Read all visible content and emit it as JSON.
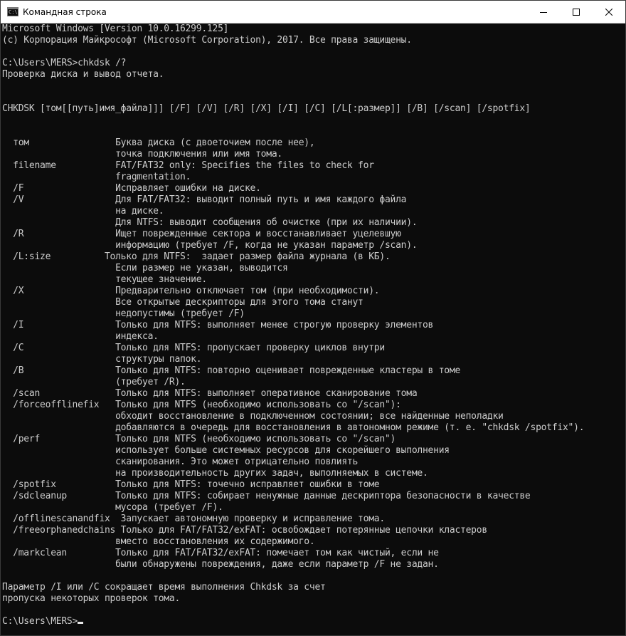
{
  "window": {
    "title": "Командная строка",
    "icon": "cmd-icon",
    "icon_glyph": "C:\\"
  },
  "console": {
    "lines": [
      "Microsoft Windows [Version 10.0.16299.125]",
      "(c) Корпорация Майкрософт (Microsoft Corporation), 2017. Все права защищены.",
      "",
      "C:\\Users\\MERS>chkdsk /?",
      "Проверка диска и вывод отчета.",
      "",
      "",
      "CHKDSK [том[[путь]имя_файла]]] [/F] [/V] [/R] [/X] [/I] [/C] [/L[:размер]] [/B] [/scan] [/spotfix]",
      "",
      "",
      "  том                Буква диска (с двоеточием после нее),",
      "                     точка подключения или имя тома.",
      "  filename           FAT/FAT32 only: Specifies the files to check for",
      "                     fragmentation.",
      "  /F                 Исправляет ошибки на диске.",
      "  /V                 Для FAT/FAT32: выводит полный путь и имя каждого файла",
      "                     на диске.",
      "                     Для NTFS: выводит сообщения об очистке (при их наличии).",
      "  /R                 Ищет поврежденные сектора и восстанавливает уцелевшую",
      "                     информацию (требует /F, когда не указан параметр /scan).",
      "  /L:size          Только для NTFS:  задает размер файла журнала (в КБ).",
      "                     Если размер не указан, выводится",
      "                     текущее значение.",
      "  /X                 Предварительно отключает том (при необходимости).",
      "                     Все открытые дескрипторы для этого тома станут",
      "                     недопустимы (требует /F)",
      "  /I                 Только для NTFS: выполняет менее строгую проверку элементов",
      "                     индекса.",
      "  /C                 Только для NTFS: пропускает проверку циклов внутри",
      "                     структуры папок.",
      "  /B                 Только для NTFS: повторно оценивает поврежденные кластеры в томе",
      "                     (требует /R).",
      "  /scan              Только для NTFS: выполняет оперативное сканирование тома",
      "  /forceofflinefix   Только для NTFS (необходимо использовать со \"/scan\"):",
      "                     обходит восстановление в подключенном состоянии; все найденные неполадки",
      "                     добавляются в очередь для восстановления в автономном режиме (т. е. \"chkdsk /spotfix\").",
      "  /perf              Только для NTFS (необходимо использовать со \"/scan\")",
      "                     использует больше системных ресурсов для скорейшего выполнения",
      "                     сканирования. Это может отрицательно повлиять",
      "                     на производительность других задач, выполняемых в системе.",
      "  /spotfix           Только для NTFS: точечно исправляет ошибки в томе",
      "  /sdcleanup         Только для NTFS: собирает ненужные данные дескриптора безопасности в качестве",
      "                     мусора (требует /F).",
      "  /offlinescanandfix  Запускает автономную проверку и исправление тома.",
      "  /freeorphanedchains Только для FAT/FAT32/exFAT: освобождает потерянные цепочки кластеров",
      "                     вместо восстановления их содержимого.",
      "  /markclean         Только для FAT/FAT32/exFAT: помечает том как чистый, если не",
      "                     были обнаружены повреждения, даже если параметр /F не задан.",
      "",
      "Параметр /I или /C сокращает время выполнения Chkdsk за счет",
      "пропуска некоторых проверок тома.",
      ""
    ],
    "prompt": "C:\\Users\\MERS>"
  },
  "controls": {
    "minimize": "minimize-icon",
    "maximize": "maximize-icon",
    "close": "close-icon"
  }
}
